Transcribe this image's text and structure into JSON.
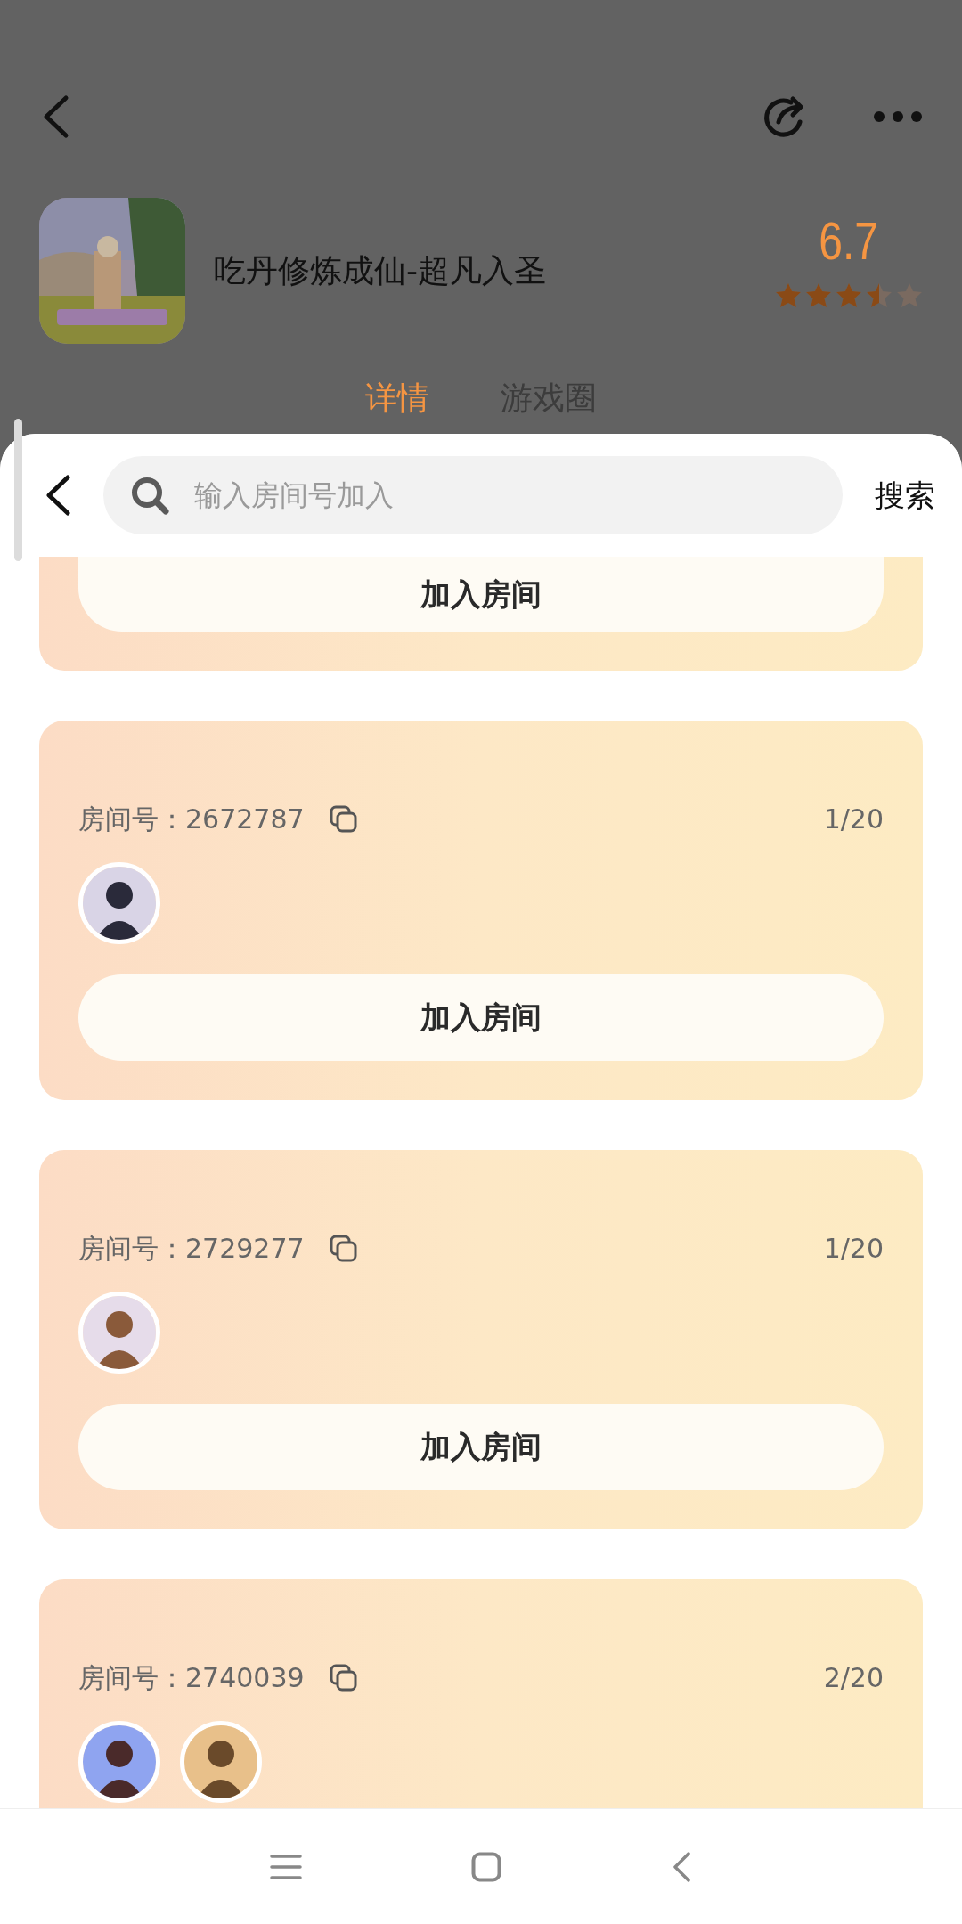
{
  "game": {
    "title": "吃丹修炼成仙-超凡入圣",
    "score": "6.7",
    "stars": 3.5
  },
  "tabs": [
    {
      "label": "详情",
      "selected": true
    },
    {
      "label": "游戏圈",
      "selected": false
    }
  ],
  "search": {
    "placeholder": "输入房间号加入",
    "button": "搜索"
  },
  "rooms": [
    {
      "join_button": "加入房间"
    },
    {
      "room_label": "房间号：2672787",
      "count": "1/20",
      "join_button": "加入房间"
    },
    {
      "room_label": "房间号：2729277",
      "count": "1/20",
      "join_button": "加入房间"
    },
    {
      "room_label": "房间号：2740039",
      "count": "2/20"
    }
  ]
}
